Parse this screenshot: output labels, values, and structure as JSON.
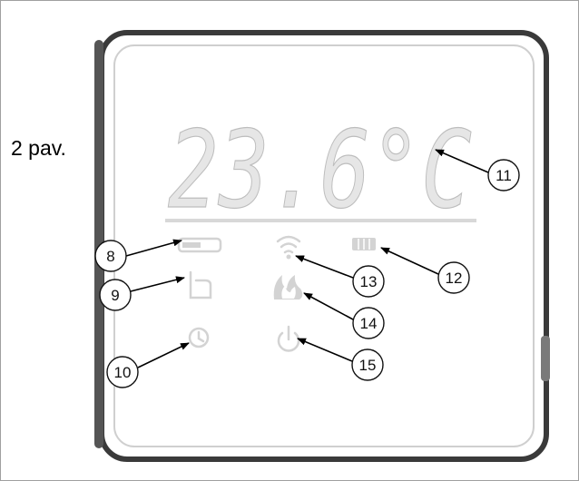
{
  "caption": "2 pav.",
  "display": {
    "temperature": "23.6°C"
  },
  "callouts": [
    "8",
    "9",
    "10",
    "11",
    "12",
    "13",
    "14",
    "15"
  ],
  "icons": {
    "8": "wifi-battery-indicator-icon",
    "9": "hand-touch-icon",
    "10": "clock-icon",
    "11": "temperature-display",
    "12": "heating-radiator-icon",
    "13": "wifi-signal-icon",
    "14": "flame-icon",
    "15": "power-icon"
  }
}
